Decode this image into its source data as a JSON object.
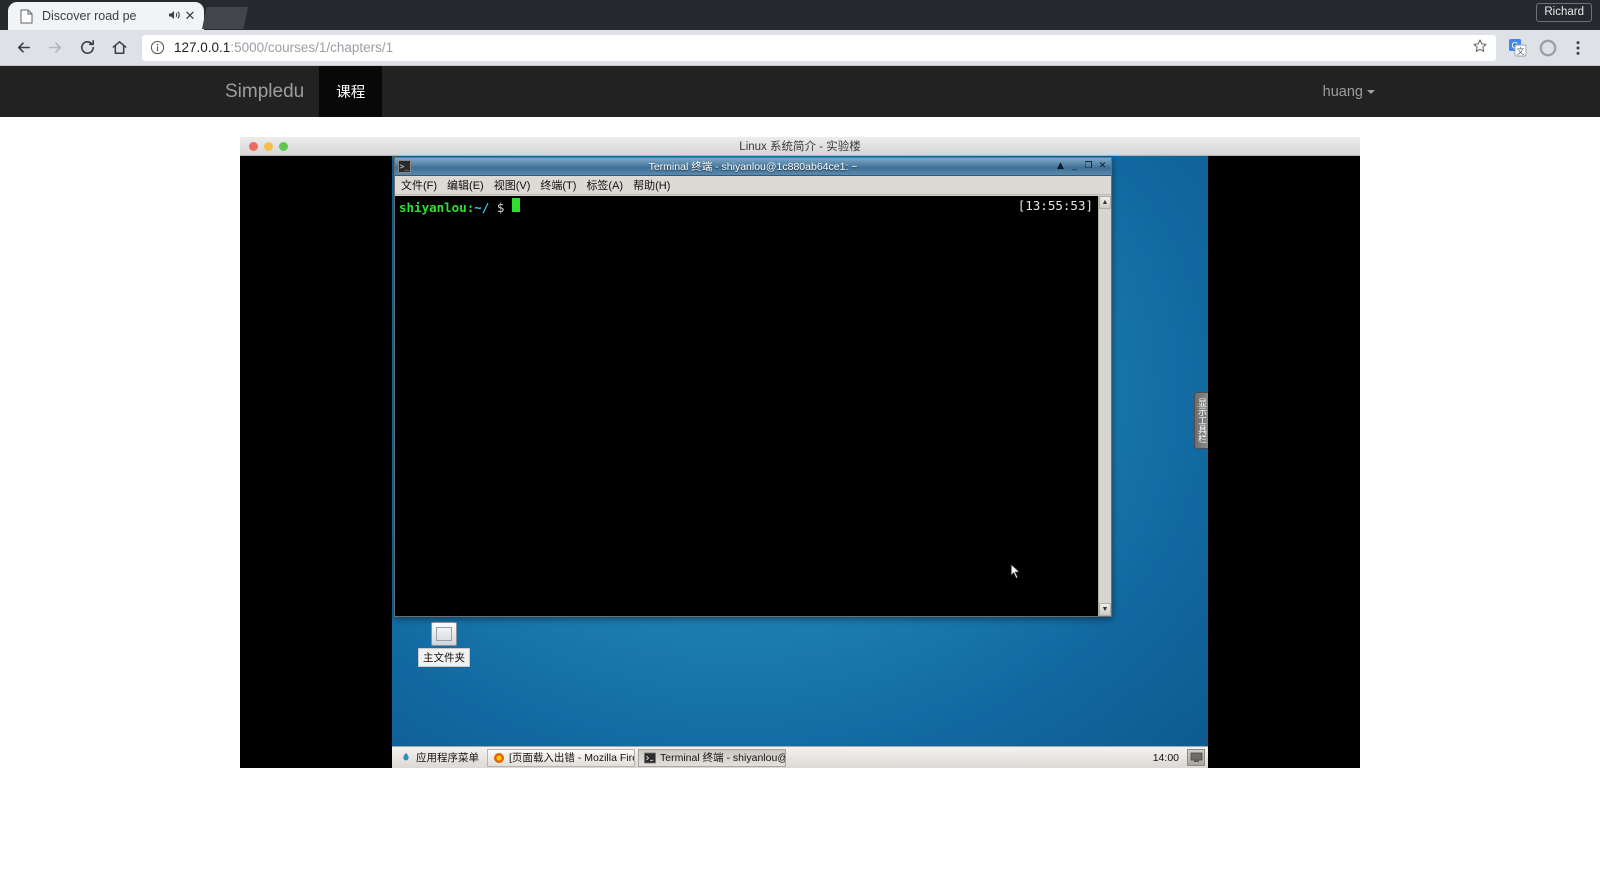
{
  "browser": {
    "tab": {
      "title": "Discover road pe",
      "favicon_icon": "page-icon",
      "audio_icon": "speaker-icon",
      "close_icon": "close-icon"
    },
    "profile_label": "Richard",
    "nav": {
      "back_icon": "back-arrow-icon",
      "forward_icon": "forward-arrow-icon",
      "reload_icon": "reload-icon",
      "home_icon": "home-icon"
    },
    "omnibox": {
      "info_icon": "info-circle-icon",
      "url_host": "127.0.0.1",
      "url_rest": ":5000/courses/1/chapters/1",
      "star_icon": "bookmark-star-icon"
    },
    "toolbar_icons": {
      "translate": "google-translate-icon",
      "avatar": "profile-circle-icon",
      "menu": "three-dot-menu-icon"
    }
  },
  "site": {
    "brand": "Simpledu",
    "nav_items": [
      {
        "label": "课程",
        "active": true
      }
    ],
    "user": {
      "name": "huang",
      "caret_icon": "caret-down-icon"
    }
  },
  "lab": {
    "window_title": "Linux 系统简介 - 实验楼",
    "traffic_lights": [
      {
        "name": "close",
        "color": "#ed6a5e"
      },
      {
        "name": "minimize",
        "color": "#f4bf4f"
      },
      {
        "name": "zoom",
        "color": "#61c554"
      }
    ],
    "toolbar_handle": "显示工具栏",
    "desktop_icon": {
      "label": "主文件夹",
      "icon": "folder-icon"
    },
    "terminal": {
      "app_icon": "terminal-icon",
      "title": "Terminal 终端 - shiyanlou@1c880ab64ce1: ~",
      "menus": [
        {
          "label": "文件(F)",
          "accel": "F"
        },
        {
          "label": "编辑(E)",
          "accel": "E"
        },
        {
          "label": "视图(V)",
          "accel": "V"
        },
        {
          "label": "终端(T)",
          "accel": "T"
        },
        {
          "label": "标签(A)",
          "accel": "A"
        },
        {
          "label": "帮助(H)",
          "accel": "H"
        }
      ],
      "window_buttons": [
        {
          "name": "shade-button",
          "glyph": "▲"
        },
        {
          "name": "minimize-button",
          "glyph": "_"
        },
        {
          "name": "maximize-button",
          "glyph": "❐"
        },
        {
          "name": "close-button",
          "glyph": "✕"
        }
      ],
      "prompt": {
        "user": "shiyanlou",
        "separator": ":",
        "path": "~/",
        "symbol": "$"
      },
      "clock": "[13:55:53]",
      "scrollbar": {
        "up_icon": "scroll-up-icon",
        "down_icon": "scroll-down-icon"
      },
      "colors": {
        "user": "#2ee02e",
        "path": "#35c5e8",
        "background": "#000000"
      }
    },
    "taskbar": {
      "menu_button": {
        "label": "应用程序菜单",
        "icon": "xfce-mouse-icon"
      },
      "windows": [
        {
          "label": "[页面载入出错 - Mozilla Fire…",
          "icon": "firefox-icon",
          "state": "normal"
        },
        {
          "label": "Terminal 终端 - shiyanlou@…",
          "icon": "terminal-icon",
          "state": "active"
        }
      ],
      "clock": "14:00",
      "tray_icon": "display-settings-icon"
    }
  }
}
